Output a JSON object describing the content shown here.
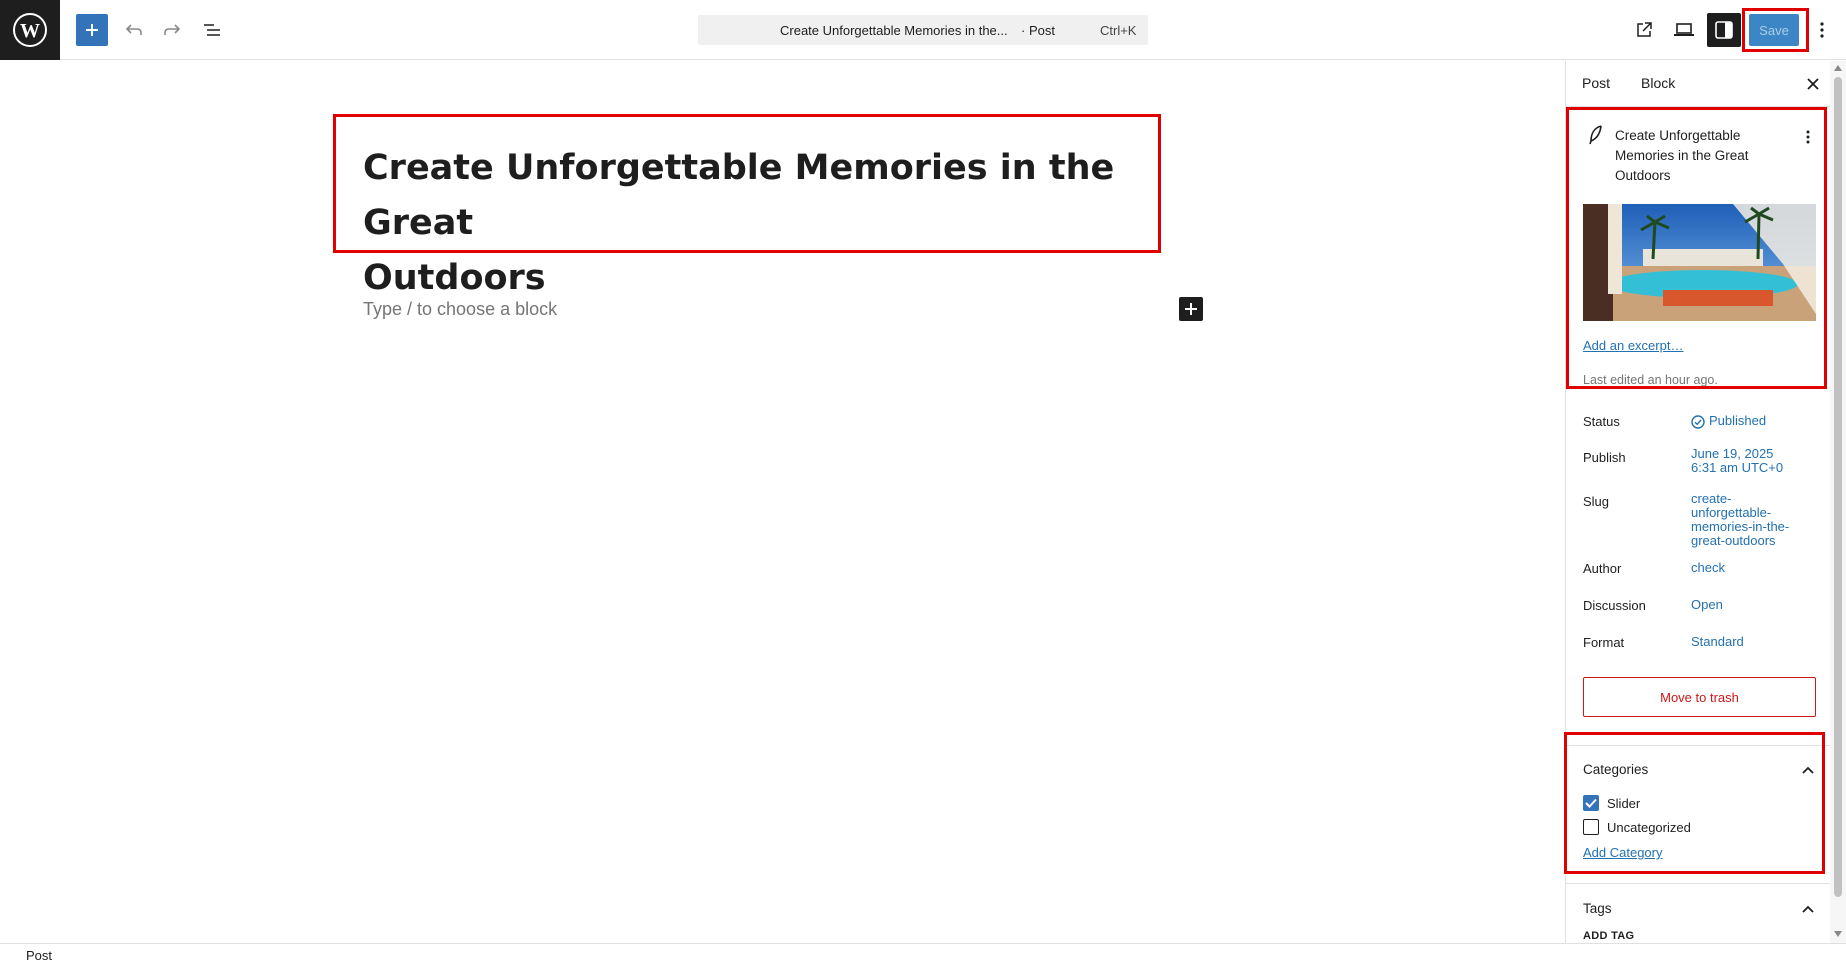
{
  "header": {
    "command_bar": {
      "title": "Create Unforgettable Memories in the...",
      "suffix": "· Post",
      "shortcut": "Ctrl+K"
    },
    "save_label": "Save"
  },
  "editor": {
    "post_title_line1": "Create Unforgettable Memories in the Great",
    "post_title_line2": "Outdoors",
    "block_placeholder": "Type / to choose a block"
  },
  "sidebar": {
    "tabs": [
      "Post",
      "Block"
    ],
    "card": {
      "title": "Create Unforgettable Memories in the Great Outdoors",
      "add_excerpt": "Add an excerpt…",
      "last_edited": "Last edited an hour ago."
    },
    "rows": [
      {
        "label": "Status",
        "value": "Published"
      },
      {
        "label": "Publish",
        "value_line1": "June 19, 2025",
        "value_line2": "6:31 am UTC+0"
      },
      {
        "label": "Slug",
        "value_lines": [
          "create-",
          "unforgettable-",
          "memories-in-the-",
          "great-outdoors"
        ]
      },
      {
        "label": "Author",
        "value": "check"
      },
      {
        "label": "Discussion",
        "value": "Open"
      },
      {
        "label": "Format",
        "value": "Standard"
      }
    ],
    "trash_label": "Move to trash",
    "categories": {
      "title": "Categories",
      "items": [
        {
          "label": "Slider",
          "checked": true
        },
        {
          "label": "Uncategorized",
          "checked": false
        }
      ],
      "add_label": "Add Category"
    },
    "tags": {
      "title": "Tags",
      "add_label": "ADD TAG"
    }
  },
  "footer": {
    "breadcrumb": "Post"
  },
  "colors": {
    "accent": "#3373b9",
    "link": "#2271b1",
    "danger": "#cc1818",
    "highlight": "#e00000"
  }
}
